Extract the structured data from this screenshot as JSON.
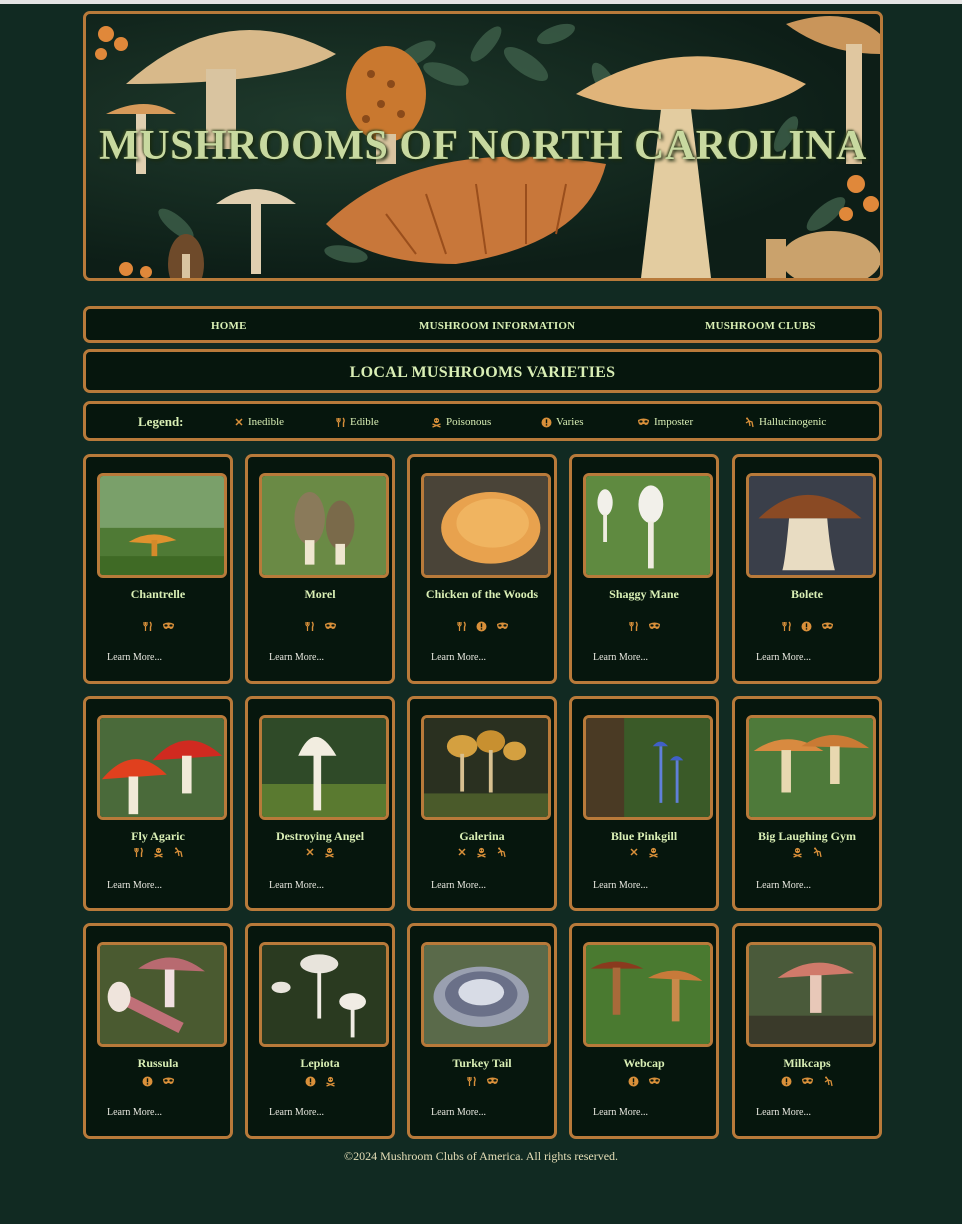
{
  "site": {
    "title": "MUSHROOMS OF NORTH CAROLINA"
  },
  "nav": [
    {
      "label": "HOME"
    },
    {
      "label": "MUSHROOM INFORMATION"
    },
    {
      "label": "MUSHROOM CLUBS"
    }
  ],
  "section": {
    "heading": "LOCAL MUSHROOMS VARIETIES"
  },
  "legend": {
    "label": "Legend:",
    "items": [
      {
        "icon": "x-icon",
        "label": "Inedible"
      },
      {
        "icon": "fork-knife-icon",
        "label": "Edible"
      },
      {
        "icon": "skull-crossbones-icon",
        "label": "Poisonous"
      },
      {
        "icon": "exclamation-circle-icon",
        "label": "Varies"
      },
      {
        "icon": "mask-icon",
        "label": "Imposter"
      },
      {
        "icon": "hallucinogenic-icon",
        "label": "Hallucinogenic"
      }
    ]
  },
  "mushrooms": [
    {
      "name": "Chantrelle",
      "tags": [
        "edible",
        "imposter"
      ],
      "link": "Learn More..."
    },
    {
      "name": "Morel",
      "tags": [
        "edible",
        "imposter"
      ],
      "link": "Learn More..."
    },
    {
      "name": "Chicken of the Woods",
      "tags": [
        "edible",
        "varies",
        "imposter"
      ],
      "link": "Learn More..."
    },
    {
      "name": "Shaggy Mane",
      "tags": [
        "edible",
        "imposter"
      ],
      "link": "Learn More..."
    },
    {
      "name": "Bolete",
      "tags": [
        "edible",
        "varies",
        "imposter"
      ],
      "link": "Learn More..."
    },
    {
      "name": "Fly Agaric",
      "tags": [
        "edible",
        "poisonous",
        "hallucinogenic"
      ],
      "link": "Learn More..."
    },
    {
      "name": "Destroying Angel",
      "tags": [
        "inedible",
        "poisonous"
      ],
      "link": "Learn More..."
    },
    {
      "name": "Galerina",
      "tags": [
        "inedible",
        "poisonous",
        "hallucinogenic"
      ],
      "link": "Learn More..."
    },
    {
      "name": "Blue Pinkgill",
      "tags": [
        "inedible",
        "poisonous"
      ],
      "link": "Learn More..."
    },
    {
      "name": "Big Laughing Gym",
      "tags": [
        "poisonous",
        "hallucinogenic"
      ],
      "link": "Learn More..."
    },
    {
      "name": "Russula",
      "tags": [
        "varies",
        "imposter"
      ],
      "link": "Learn More..."
    },
    {
      "name": "Lepiota",
      "tags": [
        "varies",
        "poisonous"
      ],
      "link": "Learn More..."
    },
    {
      "name": "Turkey Tail",
      "tags": [
        "edible",
        "imposter"
      ],
      "link": "Learn More..."
    },
    {
      "name": "Webcap",
      "tags": [
        "varies",
        "imposter"
      ],
      "link": "Learn More..."
    },
    {
      "name": "Milkcaps",
      "tags": [
        "varies",
        "imposter",
        "hallucinogenic"
      ],
      "link": "Learn More..."
    }
  ],
  "footer": {
    "text": "©2024 Mushroom Clubs of America. All rights reserved."
  },
  "colors": {
    "background": "#112a22",
    "panel": "#06160d",
    "border": "#b87a3a",
    "text": "#d9efb5",
    "icon": "#d9903a"
  }
}
